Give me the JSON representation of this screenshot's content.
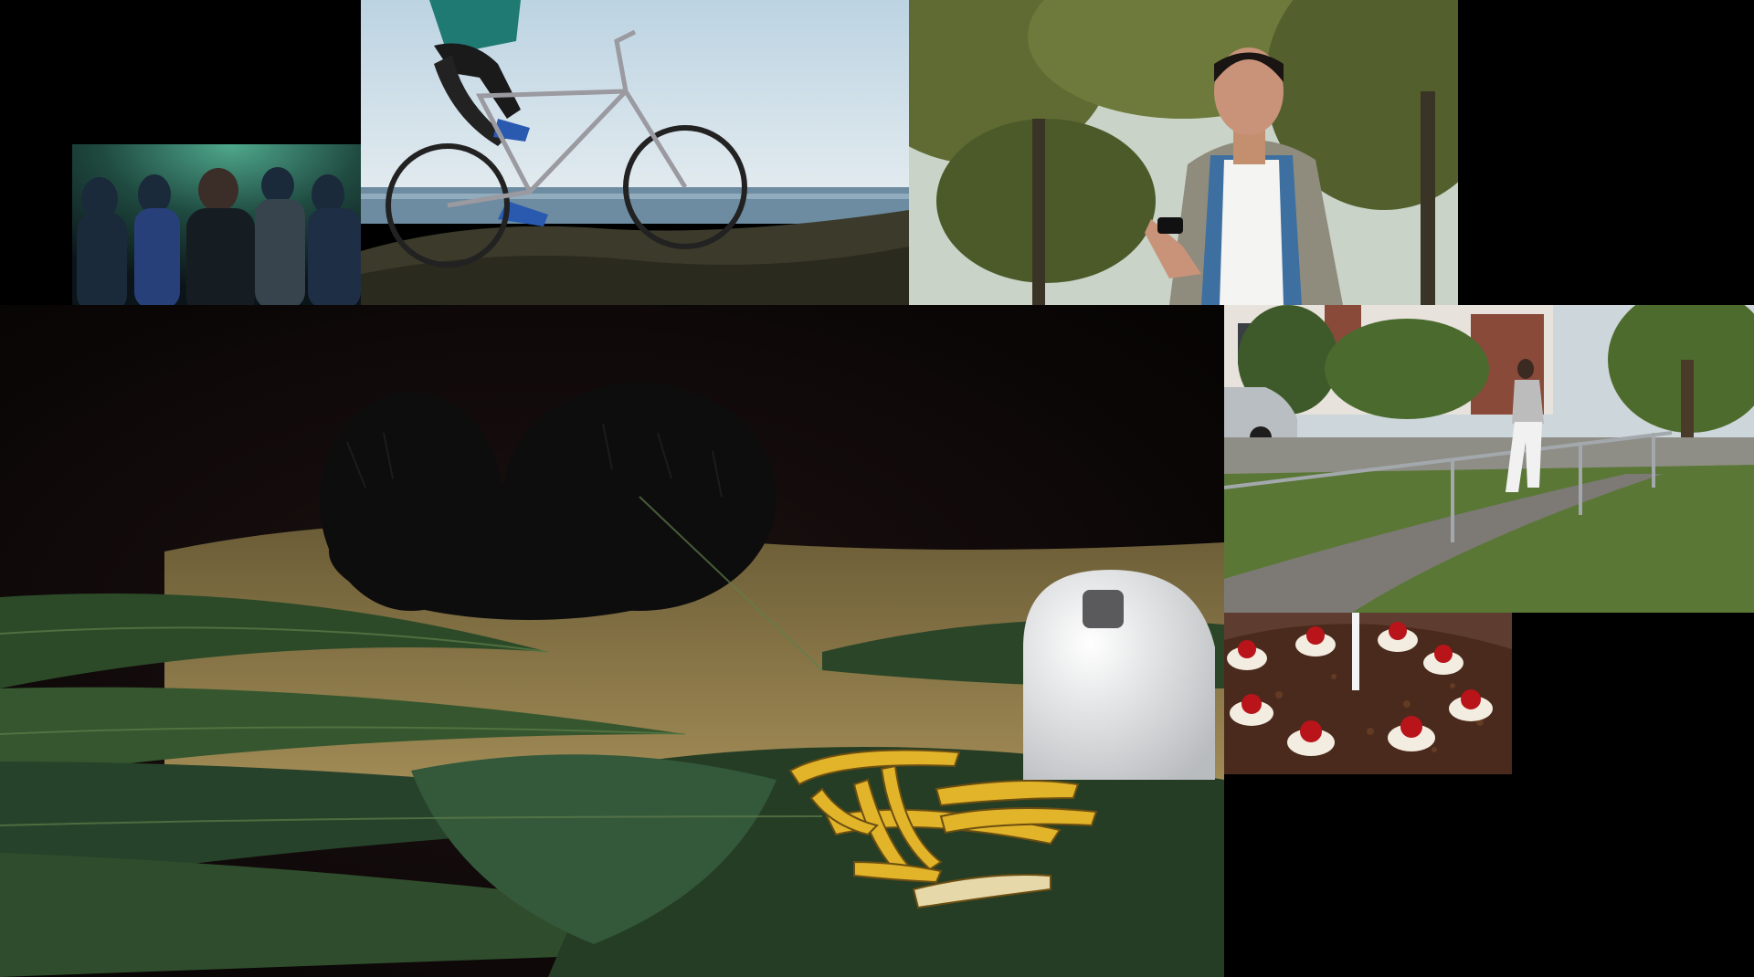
{
  "palette": {
    "background": "#000000",
    "crowd_glow": "#2f7d6a",
    "sky": "#c8dbe6",
    "sea": "#6f8fa3",
    "foliage": "#5a6b2f",
    "hay": "#8c7a4a",
    "fur": "#111111",
    "banana": "#e3b52a",
    "palm": "#2f4a2a",
    "lawn": "#5c7a38",
    "brick": "#8a4a3a",
    "cake": "#4a2a1c",
    "cream": "#f3ece0",
    "cherry": "#b8141a"
  }
}
